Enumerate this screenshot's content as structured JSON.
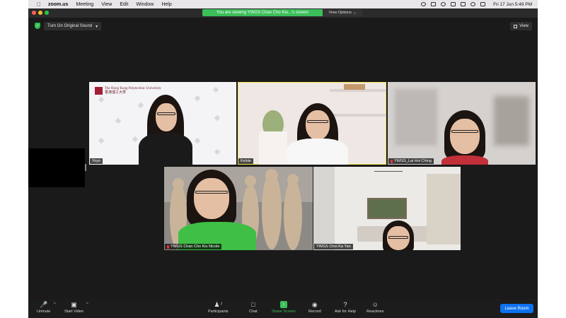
{
  "menubar": {
    "app": "zoom.us",
    "items": [
      "Meeting",
      "View",
      "Edit",
      "Window",
      "Help"
    ],
    "clock": "Fri 17 Jun  5:49 PM"
  },
  "banner": {
    "message": "You are viewing YWGS Chan Cho Kiu...'s screen",
    "options": "View Options"
  },
  "controls": {
    "original_sound": "Turn On Original Sound",
    "view": "View"
  },
  "tiles": [
    {
      "name": "Yoyo",
      "background_text": "The Hong Kong Polytechnic University",
      "background_cn": "香港理工大學"
    },
    {
      "name": "Kelsie",
      "active": true
    },
    {
      "name": "YWGS_Lai Hoi Ching"
    },
    {
      "name": "YWGS Chan Cho Kiu Nicole"
    },
    {
      "name": "YWGS Choi Ka Yan"
    }
  ],
  "toolbar": {
    "unmute": "Unmute",
    "start_video": "Start Video",
    "participants": "Participants",
    "participant_count": "7",
    "chat": "Chat",
    "share_screen": "Share Screen",
    "record": "Record",
    "ask_for_help": "Ask for Help",
    "reactions": "Reactions",
    "leave_room": "Leave Room"
  },
  "colors": {
    "share_green": "#3bbf5a",
    "leave_blue": "#0e72ed",
    "active_speaker": "#f2e94a",
    "mute_red": "#e33333"
  }
}
